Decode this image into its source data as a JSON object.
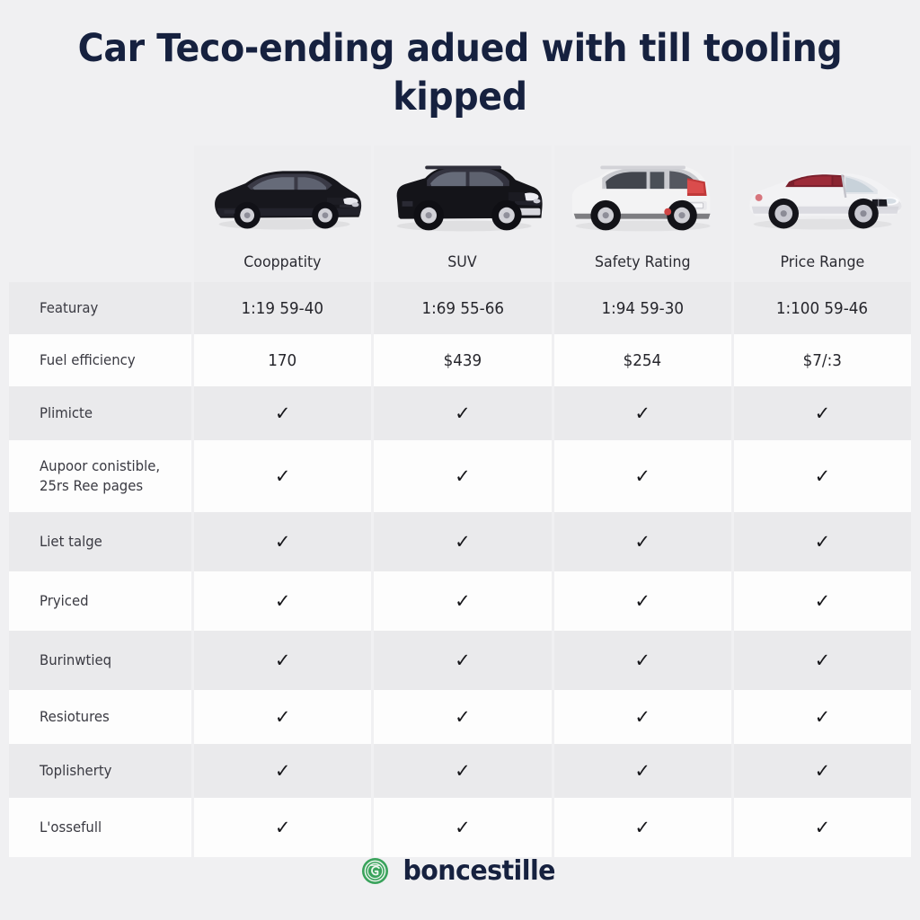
{
  "page": {
    "title": "Car Teco-ending adued with till tooling kipped",
    "background_color": "#f0f0f2",
    "title_color": "#16213f"
  },
  "table": {
    "feature_column_header": "",
    "columns": [
      {
        "label": "Cooppatity",
        "image": "black-sedan",
        "body": "sedan",
        "color": "#14141a"
      },
      {
        "label": "SUV",
        "image": "black-suv",
        "body": "suv",
        "color": "#131318"
      },
      {
        "label": "Safety Rating",
        "image": "white-crossover",
        "body": "crossover",
        "color": "#f2f2f3"
      },
      {
        "label": "Price Range",
        "image": "white-convertible",
        "body": "convertible",
        "color": "#f0f0f1"
      }
    ],
    "rows": [
      {
        "label": "Featuray",
        "values": [
          "1:19 59-40",
          "1:69 55-66",
          "1:94 59-30",
          "1:100 59-46"
        ],
        "stripe": "a"
      },
      {
        "label": "Fuel efficiency",
        "values": [
          "170",
          "$439",
          "$254",
          "$7/:3"
        ],
        "stripe": "b"
      },
      {
        "label": "Plimicte",
        "values": [
          "✓",
          "✓",
          "✓",
          "✓"
        ],
        "stripe": "a"
      },
      {
        "label": "Aupoor conistible,\n25rs Ree pages",
        "values": [
          "✓",
          "✓",
          "✓",
          "✓"
        ],
        "stripe": "b"
      },
      {
        "label": "Liet talge",
        "values": [
          "✓",
          "✓",
          "✓",
          "✓"
        ],
        "stripe": "a"
      },
      {
        "label": "Pryiced",
        "values": [
          "✓",
          "✓",
          "✓",
          "✓"
        ],
        "stripe": "b"
      },
      {
        "label": "Burinwtieq",
        "values": [
          "✓",
          "✓",
          "✓",
          "✓"
        ],
        "stripe": "a"
      },
      {
        "label": "Resiotures",
        "values": [
          "✓",
          "✓",
          "✓",
          "✓"
        ],
        "stripe": "b"
      },
      {
        "label": "Toplisherty",
        "values": [
          "✓",
          "✓",
          "✓",
          "✓"
        ],
        "stripe": "a"
      },
      {
        "label": "L'ossefull",
        "values": [
          "✓",
          "✓",
          "✓",
          "✓"
        ],
        "stripe": "b"
      }
    ]
  },
  "footer": {
    "brand": "boncestille",
    "logo_icon": "green-circle-emblem-icon",
    "logo_color": "#37a05a",
    "brand_color": "#16213f"
  }
}
